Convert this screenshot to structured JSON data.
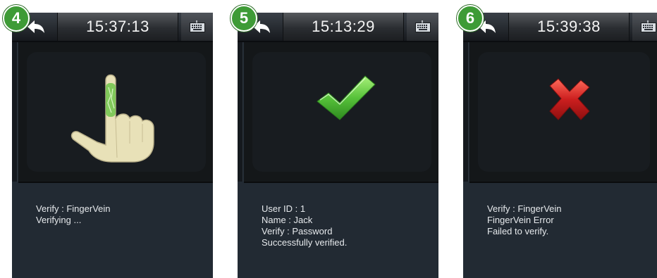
{
  "screens": [
    {
      "badge": "4",
      "time": "15:37:13",
      "icon": "fingervein-hand-icon",
      "lines": [
        "Verify : FingerVein",
        "Verifying ..."
      ]
    },
    {
      "badge": "5",
      "time": "15:13:29",
      "icon": "checkmark-icon",
      "lines": [
        "User ID : 1",
        "Name : Jack",
        "Verify : Password",
        "Successfully verified."
      ]
    },
    {
      "badge": "6",
      "time": "15:39:38",
      "icon": "red-x-icon",
      "lines": [
        "Verify : FingerVein",
        "FingerVein Error",
        "Failed to verify."
      ]
    }
  ],
  "colors": {
    "badge_green": "#3e9b36",
    "panel_bg": "#222a33",
    "success_green": "#57c23a",
    "error_red": "#cc1f1f",
    "hand_skin": "#e8e1b8"
  }
}
